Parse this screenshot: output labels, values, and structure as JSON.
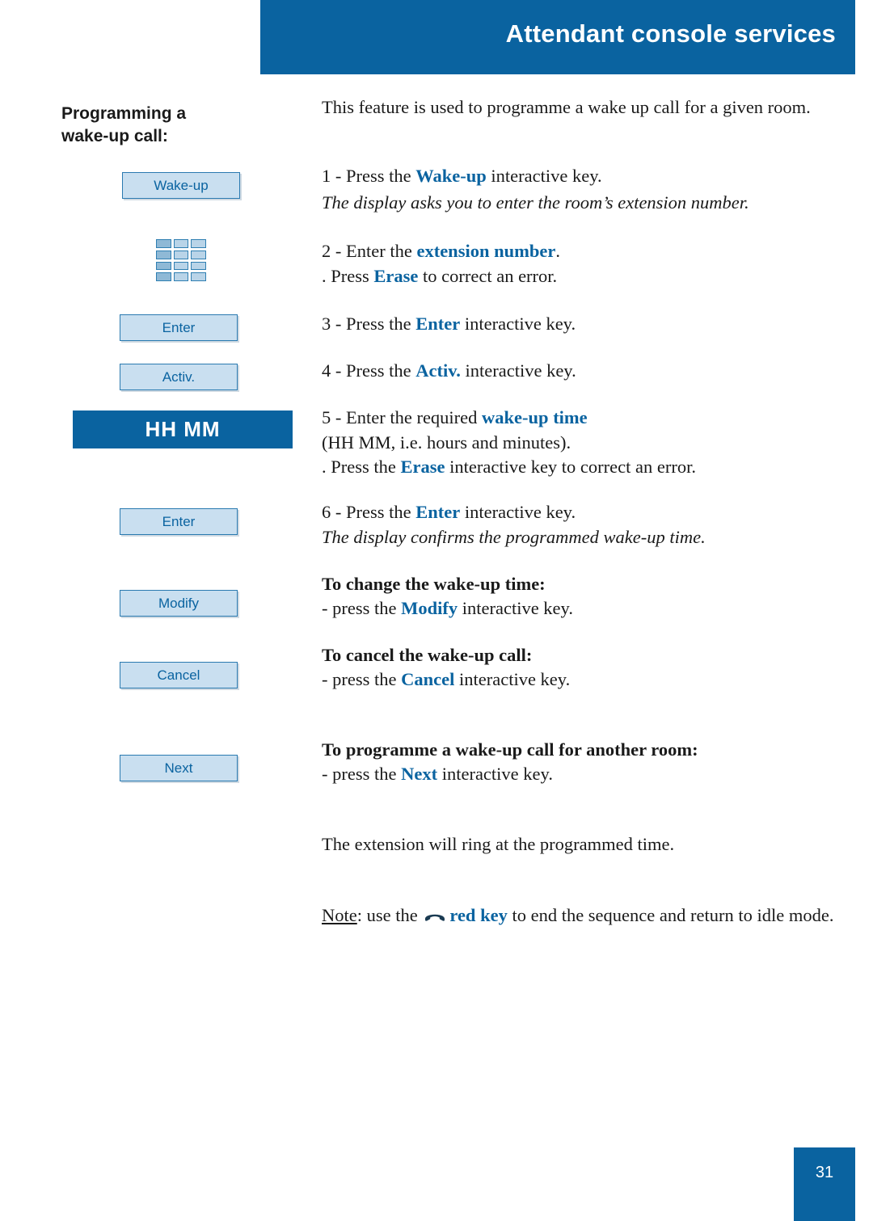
{
  "header": {
    "title": "Attendant console services"
  },
  "left": {
    "section_title": "Programming a\nwake-up call:",
    "softkeys": {
      "wakeup": "Wake-up",
      "enter1": "Enter",
      "activ": "Activ.",
      "enter2": "Enter",
      "modify": "Modify",
      "cancel": "Cancel",
      "next": "Next"
    },
    "display": {
      "hhmm": "HH MM"
    },
    "keypad_icon": "keypad-icon"
  },
  "body": {
    "intro": "This feature is used to programme a wake up call for a given room.",
    "step1_pre": "1 - Press the ",
    "step1_key": "Wake-up",
    "step1_post": " interactive key.",
    "step1_italic": "The display asks you to enter the room’s extension number.",
    "step2_pre": "2 - Enter the ",
    "step2_key": "extension number",
    "step2_post": ".",
    "step2b_pre": ". Press ",
    "step2b_key": "Erase",
    "step2b_post": " to correct an error.",
    "step3_pre": "3 - Press the ",
    "step3_key": "Enter",
    "step3_post": " interactive key.",
    "step4_pre": "4 - Press the ",
    "step4_key": "Activ.",
    "step4_post": " interactive key.",
    "step5_pre": "5 - Enter the required ",
    "step5_key": "wake-up time",
    "step5b": "(HH MM, i.e. hours and minutes).",
    "step5c_pre": ". Press the ",
    "step5c_key": "Erase",
    "step5c_post": " interactive key to correct an error.",
    "step6_pre": "6 - Press the ",
    "step6_key": "Enter",
    "step6_post": " interactive key.",
    "step6_italic": "The display confirms the programmed wake-up time.",
    "change_heading": "To change the wake-up time:",
    "change_pre": "- press the ",
    "change_key": "Modify",
    "change_post": " interactive key.",
    "cancel_heading": "To cancel the wake-up call:",
    "cancel_pre": "- press the ",
    "cancel_key": "Cancel",
    "cancel_post": " interactive key.",
    "another_heading": "To programme a wake-up call for another room:",
    "another_pre": "- press the ",
    "another_key": "Next",
    "another_post": " interactive key.",
    "ring": "The extension will ring at the programmed time.",
    "note_label": "Note",
    "note_pre": ": use the ",
    "note_key": "red key",
    "note_post": " to end the sequence and return to idle mode."
  },
  "footer": {
    "page_number": "31"
  },
  "colors": {
    "brand_blue": "#0a63a0",
    "softkey_fill": "#c9dff0",
    "softkey_border": "#2a7ab0"
  }
}
